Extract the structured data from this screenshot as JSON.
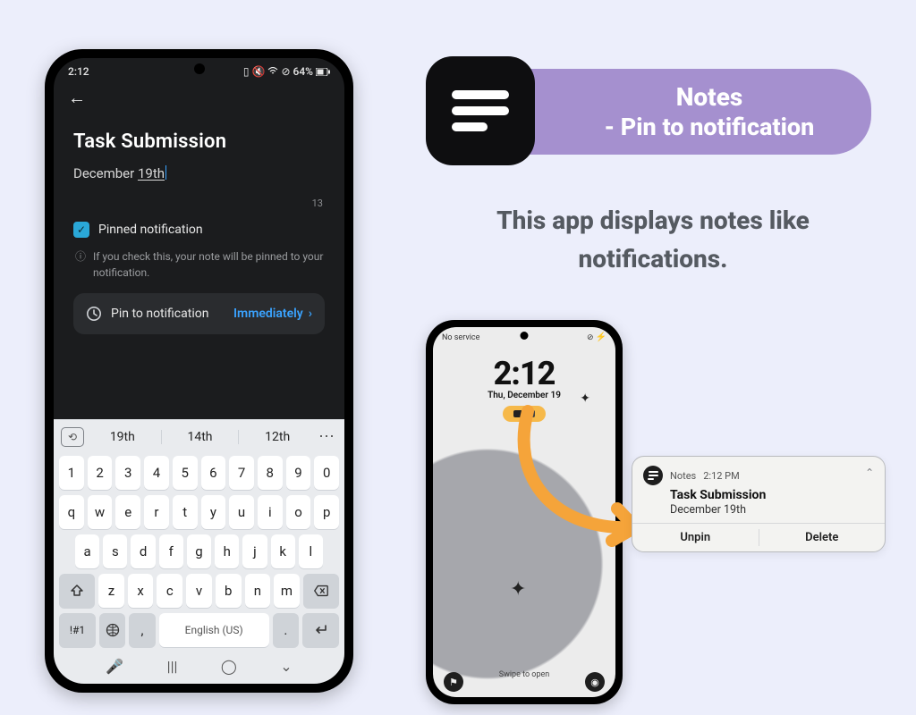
{
  "colors": {
    "bg": "#eceefb",
    "accent": "#a590cf",
    "link": "#3aa3ff",
    "highlight": "#f6b94a"
  },
  "header": {
    "title_line1": "Notes",
    "title_line2": "- Pin to notification"
  },
  "tagline": "This app displays notes like notifications.",
  "editor_phone": {
    "status": {
      "time": "2:12",
      "battery": "64%"
    },
    "note": {
      "title": "Task Submission",
      "body_prefix": "December ",
      "body_underlined": "19th",
      "char_count": "13"
    },
    "pinned_checkbox": {
      "label": "Pinned notification",
      "checked": true
    },
    "hint": "If you check this, your note will be pinned to your notification.",
    "pin_card": {
      "label": "Pin to notification",
      "value": "Immediately"
    },
    "keyboard": {
      "suggestions": [
        "19th",
        "14th",
        "12th"
      ],
      "row_num": [
        "1",
        "2",
        "3",
        "4",
        "5",
        "6",
        "7",
        "8",
        "9",
        "0"
      ],
      "row_top": [
        "q",
        "w",
        "e",
        "r",
        "t",
        "y",
        "u",
        "i",
        "o",
        "p"
      ],
      "row_mid": [
        "a",
        "s",
        "d",
        "f",
        "g",
        "h",
        "j",
        "k",
        "l"
      ],
      "row_bot": [
        "z",
        "x",
        "c",
        "v",
        "b",
        "n",
        "m"
      ],
      "sym_key": "!#1",
      "comma_key": ",",
      "period_key": ".",
      "space_label": "English (US)"
    }
  },
  "lock_phone": {
    "status": {
      "carrier": "No service"
    },
    "clock": "2:12",
    "date": "Thu, December 19",
    "swipe": "Swipe to open"
  },
  "notification": {
    "app_name": "Notes",
    "time": "2:12 PM",
    "title": "Task Submission",
    "body": "December 19th",
    "actions": {
      "left": "Unpin",
      "right": "Delete"
    }
  }
}
